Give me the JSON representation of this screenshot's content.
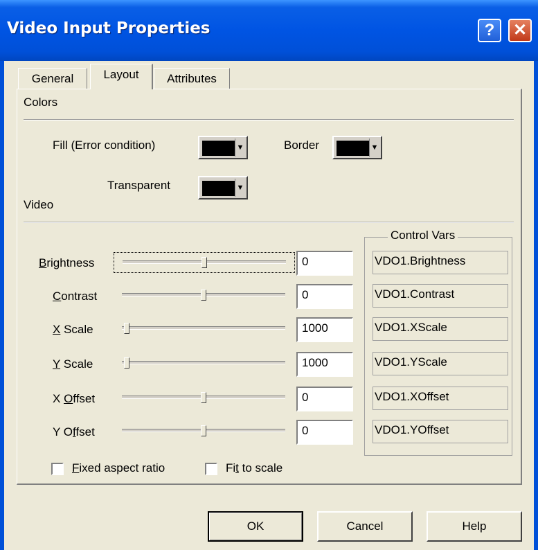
{
  "window": {
    "title": "Video Input Properties",
    "help_glyph": "?",
    "close_glyph": "✕"
  },
  "tabs": [
    {
      "label": "General",
      "active": false
    },
    {
      "label": "Layout",
      "active": true
    },
    {
      "label": "Attributes",
      "active": false
    }
  ],
  "colors_section": {
    "heading": "Colors",
    "fill_label": "Fill (Error condition)",
    "border_label": "Border",
    "transparent_label": "Transparent",
    "fill_color": "#000000",
    "border_color": "#000000",
    "transparent_color": "#000000",
    "dropdown_glyph": "▼"
  },
  "video_section": {
    "heading": "Video",
    "control_vars_title": "Control Vars",
    "rows": [
      {
        "label_pre": "",
        "label_mn": "B",
        "label_post": "rightness",
        "value": "0",
        "var": "VDO1.Brightness"
      },
      {
        "label_pre": "",
        "label_mn": "C",
        "label_post": "ontrast",
        "value": "0",
        "var": "VDO1.Contrast"
      },
      {
        "label_pre": "",
        "label_mn": "X",
        "label_post": " Scale",
        "value": "1000",
        "var": "VDO1.XScale"
      },
      {
        "label_pre": "",
        "label_mn": "Y",
        "label_post": " Scale",
        "value": "1000",
        "var": "VDO1.YScale"
      },
      {
        "label_pre": "X ",
        "label_mn": "O",
        "label_post": "ffset",
        "value": "0",
        "var": "VDO1.XOffset"
      },
      {
        "label_pre": "Y O",
        "label_mn": "f",
        "label_post": "fset",
        "value": "0",
        "var": "VDO1.YOffset"
      }
    ],
    "slider_levels": [
      0.5,
      0.5,
      0.03,
      0.03,
      0.5,
      0.5
    ]
  },
  "options": {
    "fixed_aspect": {
      "mn": "F",
      "rest": "ixed aspect ratio",
      "checked": false
    },
    "fit_to_scale": {
      "pre": "Fi",
      "mn": "t",
      "rest": " to scale",
      "checked": false
    }
  },
  "buttons": {
    "ok": "OK",
    "cancel": "Cancel",
    "help": "Help"
  }
}
